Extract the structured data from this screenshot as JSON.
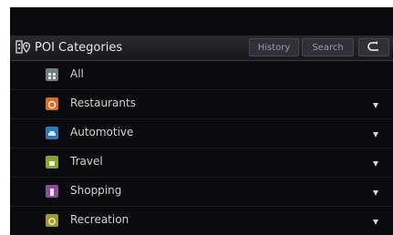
{
  "header": {
    "title": "POI Categories",
    "title_icon": "poi-categories-icon",
    "history_label": "History",
    "search_label": "Search",
    "back_icon": "back-arrow-icon"
  },
  "categories": [
    {
      "label": "All",
      "icon": "all-icon",
      "color": "#6f7f7f",
      "expandable": false
    },
    {
      "label": "Restaurants",
      "icon": "restaurant-icon",
      "color": "#e06a1f",
      "expandable": true
    },
    {
      "label": "Automotive",
      "icon": "car-icon",
      "color": "#2b79c2",
      "expandable": true
    },
    {
      "label": "Travel",
      "icon": "travel-icon",
      "color": "#8aa32a",
      "expandable": true
    },
    {
      "label": "Shopping",
      "icon": "shopping-icon",
      "color": "#8a4f9b",
      "expandable": true
    },
    {
      "label": "Recreation",
      "icon": "recreation-icon",
      "color": "#9c9a2c",
      "expandable": true
    }
  ]
}
